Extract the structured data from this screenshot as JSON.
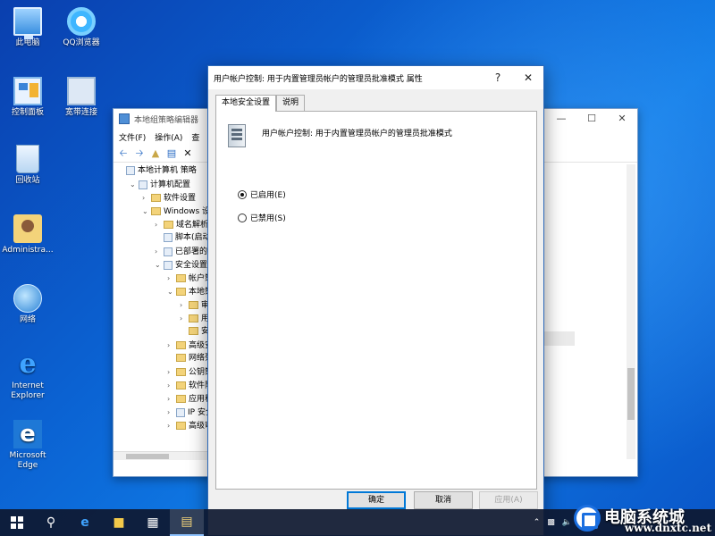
{
  "desktop": {
    "icons": [
      {
        "label": "此电脑",
        "icon": "computer-icon"
      },
      {
        "label": "QQ浏览器",
        "icon": "qq-browser-icon"
      },
      {
        "label": "控制面板",
        "icon": "control-panel-icon"
      },
      {
        "label": "宽带连接",
        "icon": "broadband-icon"
      },
      {
        "label": "回收站",
        "icon": "recycle-bin-icon"
      },
      {
        "label": "Administra...",
        "icon": "user-folder-icon"
      },
      {
        "label": "网络",
        "icon": "network-icon"
      },
      {
        "label": "Internet Explorer",
        "icon": "ie-icon"
      },
      {
        "label": "Microsoft Edge",
        "icon": "edge-icon"
      }
    ]
  },
  "gpedit": {
    "title": "本地组策略编辑器",
    "menu": [
      "文件(F)",
      "操作(A)",
      "查"
    ],
    "tree": [
      {
        "label": "本地计算机 策略",
        "indent": 0,
        "arrow": "",
        "kind": "sheet"
      },
      {
        "label": "计算机配置",
        "indent": 1,
        "arrow": "v",
        "kind": "sheet"
      },
      {
        "label": "软件设置",
        "indent": 2,
        "arrow": ">",
        "kind": "folder"
      },
      {
        "label": "Windows 设",
        "indent": 2,
        "arrow": "v",
        "kind": "folder"
      },
      {
        "label": "域名解析",
        "indent": 3,
        "arrow": ">",
        "kind": "folder"
      },
      {
        "label": "脚本(启动",
        "indent": 3,
        "arrow": "",
        "kind": "sheet"
      },
      {
        "label": "已部署的",
        "indent": 3,
        "arrow": ">",
        "kind": "sheet"
      },
      {
        "label": "安全设置",
        "indent": 3,
        "arrow": "v",
        "kind": "sheet"
      },
      {
        "label": "帐户策",
        "indent": 4,
        "arrow": ">",
        "kind": "folder"
      },
      {
        "label": "本地策",
        "indent": 4,
        "arrow": "v",
        "kind": "folder"
      },
      {
        "label": "审",
        "indent": 5,
        "arrow": ">",
        "kind": "folder"
      },
      {
        "label": "用",
        "indent": 5,
        "arrow": ">",
        "kind": "folder"
      },
      {
        "label": "安",
        "indent": 5,
        "arrow": "",
        "kind": "folder"
      },
      {
        "label": "高级安",
        "indent": 4,
        "arrow": ">",
        "kind": "folder"
      },
      {
        "label": "网络列",
        "indent": 4,
        "arrow": "",
        "kind": "folder"
      },
      {
        "label": "公钥策",
        "indent": 4,
        "arrow": ">",
        "kind": "folder"
      },
      {
        "label": "软件限",
        "indent": 4,
        "arrow": ">",
        "kind": "folder"
      },
      {
        "label": "应用程",
        "indent": 4,
        "arrow": ">",
        "kind": "folder"
      },
      {
        "label": "IP 安全",
        "indent": 4,
        "arrow": ">",
        "kind": "sheet"
      },
      {
        "label": "高级审",
        "indent": 4,
        "arrow": ">",
        "kind": "folder"
      }
    ]
  },
  "dialog": {
    "title": "用户帐户控制: 用于内置管理员帐户的管理员批准模式 属性",
    "help": "?",
    "close": "✕",
    "tabs": [
      "本地安全设置",
      "说明"
    ],
    "active_tab": 0,
    "policy_name": "用户帐户控制: 用于内置管理员帐户的管理员批准模式",
    "options": [
      {
        "label": "已启用(E)",
        "checked": true
      },
      {
        "label": "已禁用(S)",
        "checked": false
      }
    ],
    "buttons": {
      "ok": "确定",
      "cancel": "取消",
      "apply": "应用(A)"
    }
  },
  "watermark": {
    "text": "电脑系统城",
    "url": "www.dnxtc.net"
  }
}
